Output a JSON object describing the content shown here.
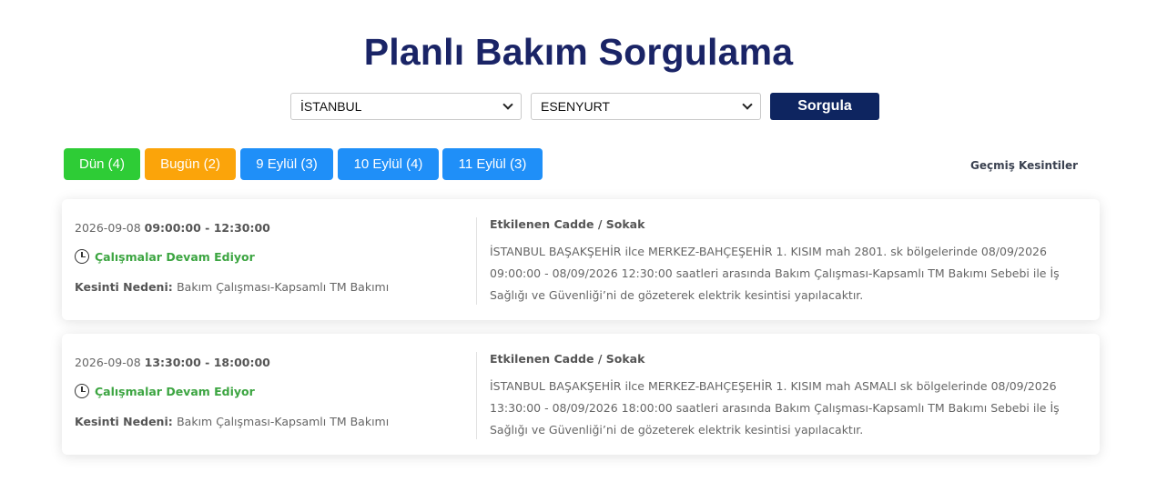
{
  "page": {
    "title": "Planlı Bakım Sorgulama"
  },
  "search": {
    "city": "İSTANBUL",
    "district": "ESENYURT",
    "button_label": "Sorgula"
  },
  "tabs": [
    {
      "label": "Dün (4)",
      "color": "#2ecc36"
    },
    {
      "label": "Bugün (2)",
      "color": "#fba40a"
    },
    {
      "label": "9 Eylül (3)",
      "color": "#1f8ff8"
    },
    {
      "label": "10 Eylül (4)",
      "color": "#1f8ff8"
    },
    {
      "label": "11 Eylül (3)",
      "color": "#1f8ff8"
    }
  ],
  "past_link": "Geçmiş Kesintiler",
  "outages": [
    {
      "date": "2026-09-08",
      "time_range": "09:00:00 - 12:30:00",
      "status": "Çalışmalar Devam Ediyor",
      "reason_label": "Kesinti Nedeni:",
      "reason": "Bakım Çalışması-Kapsamlı TM Bakımı",
      "area_heading": "Etkilenen Cadde / Sokak",
      "area_text": "İSTANBUL BAŞAKŞEHİR ilce MERKEZ-BAHÇEŞEHİR 1. KISIM mah 2801. sk bölgelerinde 08/09/2026 09:00:00 - 08/09/2026 12:30:00 saatleri arasında Bakım Çalışması-Kapsamlı TM Bakımı Sebebi ile İş Sağlığı ve Güvenliği’ni de gözeterek elektrik kesintisi yapılacaktır."
    },
    {
      "date": "2026-09-08",
      "time_range": "13:30:00 - 18:00:00",
      "status": "Çalışmalar Devam Ediyor",
      "reason_label": "Kesinti Nedeni:",
      "reason": "Bakım Çalışması-Kapsamlı TM Bakımı",
      "area_heading": "Etkilenen Cadde / Sokak",
      "area_text": "İSTANBUL BAŞAKŞEHİR ilce MERKEZ-BAHÇEŞEHİR 1. KISIM mah ASMALI sk bölgelerinde 08/09/2026 13:30:00 - 08/09/2026 18:00:00 saatleri arasında Bakım Çalışması-Kapsamlı TM Bakımı Sebebi ile İş Sağlığı ve Güvenliği’ni de gözeterek elektrik kesintisi yapılacaktır."
    }
  ],
  "colors": {
    "title": "#1a2466",
    "button": "#0e2560",
    "status": "#3ca541"
  }
}
